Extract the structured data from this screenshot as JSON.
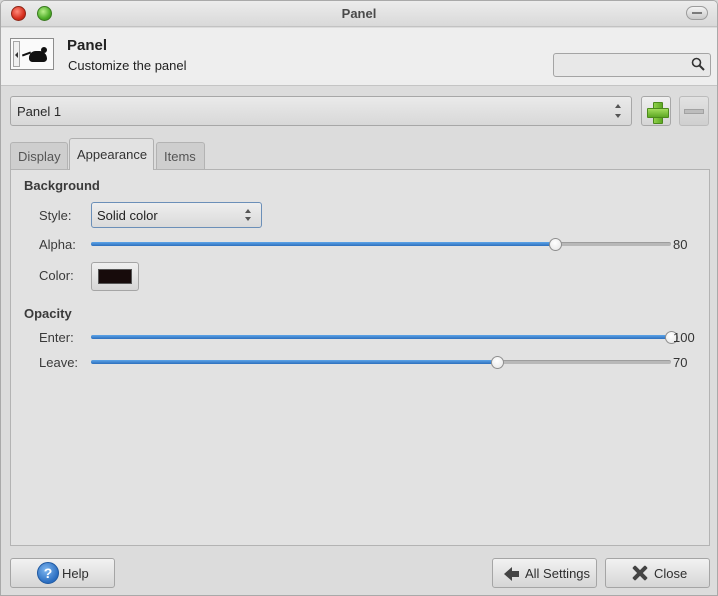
{
  "window": {
    "title": "Panel"
  },
  "header": {
    "title": "Panel",
    "subtitle": "Customize the panel",
    "icon": "panel-mouse-icon"
  },
  "search": {
    "value": "",
    "placeholder": ""
  },
  "panel_selector": {
    "selected": "Panel 1"
  },
  "tabs": [
    {
      "label": "Display",
      "active": false
    },
    {
      "label": "Appearance",
      "active": true
    },
    {
      "label": "Items",
      "active": false
    }
  ],
  "background": {
    "heading": "Background",
    "style_label": "Style:",
    "style_value": "Solid color",
    "alpha_label": "Alpha:",
    "alpha_value": "80",
    "alpha_percent": 80,
    "color_label": "Color:",
    "color_value": "#170b0b"
  },
  "opacity": {
    "heading": "Opacity",
    "enter_label": "Enter:",
    "enter_value": "100",
    "enter_percent": 100,
    "leave_label": "Leave:",
    "leave_value": "70",
    "leave_percent": 70
  },
  "buttons": {
    "help": "Help",
    "all_settings": "All Settings",
    "close": "Close"
  },
  "colors": {
    "accent": "#2d6fbd"
  }
}
